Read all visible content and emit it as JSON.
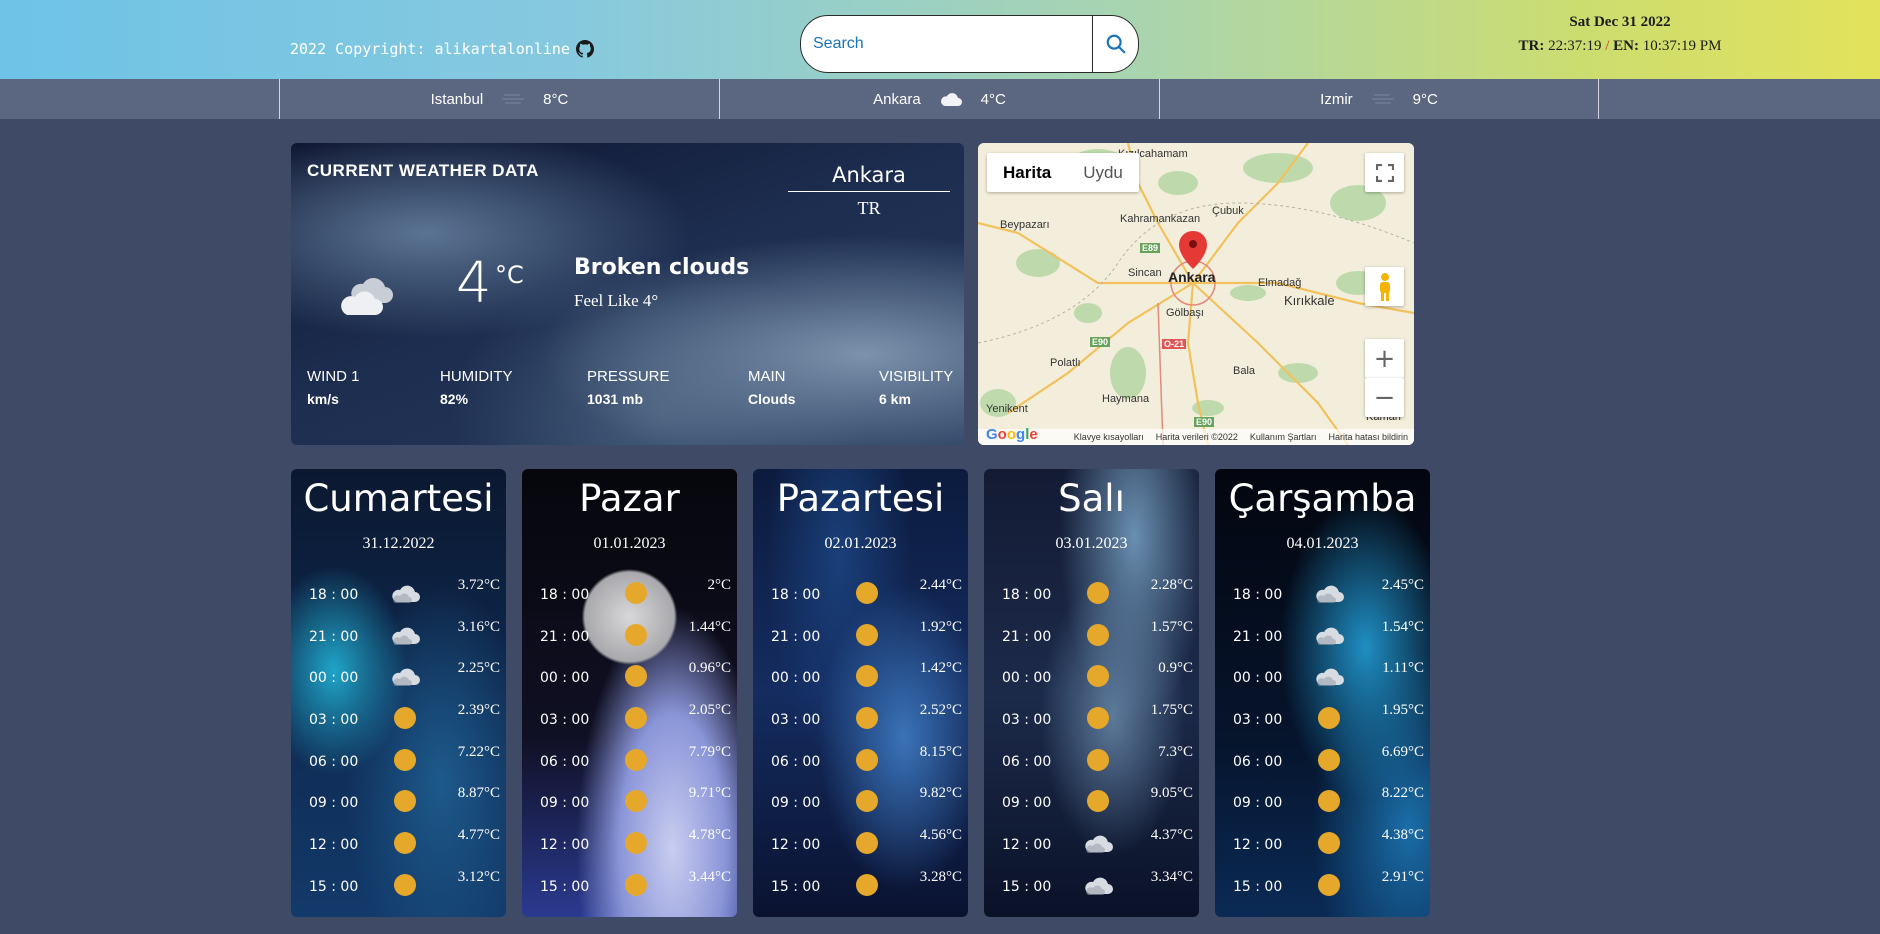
{
  "header": {
    "copyright": "2022 Copyright: alikartalonline",
    "search_placeholder": "Search",
    "date": "Sat Dec 31 2022",
    "tr_label": "TR:",
    "tr_time": "22:37:19",
    "separator": "/",
    "en_label": "EN:",
    "en_time": "10:37:19 PM"
  },
  "cities": [
    {
      "name": "Istanbul",
      "temp": "8°C",
      "icon": "mist-icon"
    },
    {
      "name": "Ankara",
      "temp": "4°C",
      "icon": "cloud-icon"
    },
    {
      "name": "Izmir",
      "temp": "9°C",
      "icon": "mist-icon"
    }
  ],
  "current": {
    "title": "CURRENT WEATHER DATA",
    "city": "Ankara",
    "country": "TR",
    "temp": "4",
    "unit": "°C",
    "description": "Broken clouds",
    "feels_like": "Feel Like 4°",
    "stats": [
      {
        "label": "WIND 1",
        "value": "km/s"
      },
      {
        "label": "HUMIDITY",
        "value": "82%"
      },
      {
        "label": "PRESSURE",
        "value": "1031 mb"
      },
      {
        "label": "MAIN",
        "value": "Clouds"
      },
      {
        "label": "VISIBILITY",
        "value": "6 km"
      }
    ]
  },
  "map": {
    "tab_map": "Harita",
    "tab_satellite": "Uydu",
    "labels": [
      "Kızılcahamam",
      "Beypazarı",
      "Kahramankazan",
      "Çubuk",
      "Sincan",
      "Ankara",
      "Elmadağ",
      "Kırıkkale",
      "Gölbaşı",
      "Polatlı",
      "Bala",
      "Haymana",
      "Yenikent",
      "Kaman"
    ],
    "road_labels": [
      "E89",
      "E90",
      "O-21",
      "E90"
    ],
    "footer": [
      "Klavye kısayolları",
      "Harita verileri ©2022",
      "Kullanım Şartları",
      "Harita hatası bildirin"
    ],
    "brand": "Google"
  },
  "forecast": [
    {
      "day": "Cumartesi",
      "date": "31.12.2022",
      "rows": [
        [
          "18 : 00",
          "cloud",
          "3.72°C"
        ],
        [
          "21 : 00",
          "cloud",
          "3.16°C"
        ],
        [
          "00 : 00",
          "cloud",
          "2.25°C"
        ],
        [
          "03 : 00",
          "sun",
          "2.39°C"
        ],
        [
          "06 : 00",
          "sun",
          "7.22°C"
        ],
        [
          "09 : 00",
          "sun",
          "8.87°C"
        ],
        [
          "12 : 00",
          "sun",
          "4.77°C"
        ],
        [
          "15 : 00",
          "sun",
          "3.12°C"
        ]
      ]
    },
    {
      "day": "Pazar",
      "date": "01.01.2023",
      "rows": [
        [
          "18 : 00",
          "sun",
          "2°C"
        ],
        [
          "21 : 00",
          "sun",
          "1.44°C"
        ],
        [
          "00 : 00",
          "sun",
          "0.96°C"
        ],
        [
          "03 : 00",
          "sun",
          "2.05°C"
        ],
        [
          "06 : 00",
          "sun",
          "7.79°C"
        ],
        [
          "09 : 00",
          "sun",
          "9.71°C"
        ],
        [
          "12 : 00",
          "sun",
          "4.78°C"
        ],
        [
          "15 : 00",
          "sun",
          "3.44°C"
        ]
      ]
    },
    {
      "day": "Pazartesi",
      "date": "02.01.2023",
      "rows": [
        [
          "18 : 00",
          "sun",
          "2.44°C"
        ],
        [
          "21 : 00",
          "sun",
          "1.92°C"
        ],
        [
          "00 : 00",
          "sun",
          "1.42°C"
        ],
        [
          "03 : 00",
          "sun",
          "2.52°C"
        ],
        [
          "06 : 00",
          "sun",
          "8.15°C"
        ],
        [
          "09 : 00",
          "sun",
          "9.82°C"
        ],
        [
          "12 : 00",
          "sun",
          "4.56°C"
        ],
        [
          "15 : 00",
          "sun",
          "3.28°C"
        ]
      ]
    },
    {
      "day": "Salı",
      "date": "03.01.2023",
      "rows": [
        [
          "18 : 00",
          "sun",
          "2.28°C"
        ],
        [
          "21 : 00",
          "sun",
          "1.57°C"
        ],
        [
          "00 : 00",
          "sun",
          "0.9°C"
        ],
        [
          "03 : 00",
          "sun",
          "1.75°C"
        ],
        [
          "06 : 00",
          "sun",
          "7.3°C"
        ],
        [
          "09 : 00",
          "sun",
          "9.05°C"
        ],
        [
          "12 : 00",
          "cloud",
          "4.37°C"
        ],
        [
          "15 : 00",
          "cloud",
          "3.34°C"
        ]
      ]
    },
    {
      "day": "Çarşamba",
      "date": "04.01.2023",
      "rows": [
        [
          "18 : 00",
          "cloud",
          "2.45°C"
        ],
        [
          "21 : 00",
          "cloud",
          "1.54°C"
        ],
        [
          "00 : 00",
          "cloud",
          "1.11°C"
        ],
        [
          "03 : 00",
          "sun",
          "1.95°C"
        ],
        [
          "06 : 00",
          "sun",
          "6.69°C"
        ],
        [
          "09 : 00",
          "sun",
          "8.22°C"
        ],
        [
          "12 : 00",
          "sun",
          "4.38°C"
        ],
        [
          "15 : 00",
          "sun",
          "2.91°C"
        ]
      ]
    }
  ],
  "colors": {
    "page_bg": "#3e4a66",
    "citybar_bg": "#5b6780",
    "sun": "#e5a82b",
    "accent_link": "#1a73b8",
    "pin": "#e53935"
  }
}
